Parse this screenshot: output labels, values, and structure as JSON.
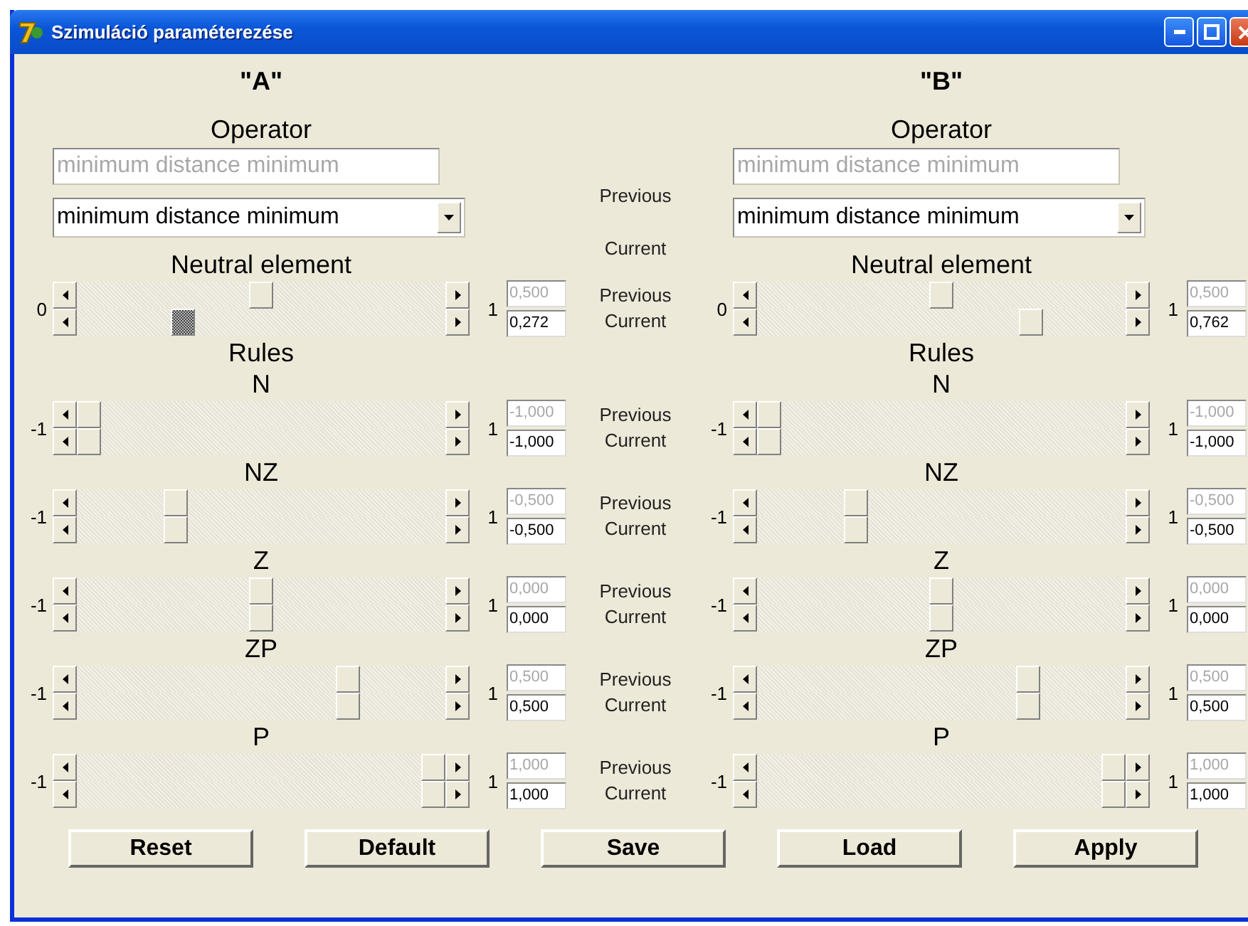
{
  "window": {
    "title": "Szimuláció paraméterezése"
  },
  "headings": [
    "\"A\"",
    "\"B\""
  ],
  "operator": {
    "labels": {
      "previous": "Previous",
      "current": "Current"
    },
    "sides": [
      {
        "title": "Operator",
        "previous_value": "minimum distance minimum",
        "current_value": "minimum distance minimum"
      },
      {
        "title": "Operator",
        "previous_value": "minimum distance minimum",
        "current_value": "minimum distance minimum"
      }
    ]
  },
  "neutral": {
    "labels": {
      "previous": "Previous",
      "current": "Current"
    },
    "sides": [
      {
        "title": "Neutral element",
        "min": "0",
        "max": "1",
        "previous": {
          "level": 0.5,
          "value": "0,500"
        },
        "current": {
          "level": 0.272,
          "value": "0,272",
          "focused": true
        }
      },
      {
        "title": "Neutral element",
        "min": "0",
        "max": "1",
        "previous": {
          "level": 0.5,
          "value": "0,500"
        },
        "current": {
          "level": 0.762,
          "value": "0,762",
          "focused": false
        }
      }
    ]
  },
  "rules_headings": [
    "Rules",
    "Rules"
  ],
  "rules": [
    {
      "labels": {
        "previous": "Previous",
        "current": "Current"
      },
      "sides": [
        {
          "title": "N",
          "min": "-1",
          "max": "1",
          "previous": {
            "level": 0,
            "value": "-1,000"
          },
          "current": {
            "level": 0,
            "value": "-1,000",
            "focused": false
          }
        },
        {
          "title": "N",
          "min": "-1",
          "max": "1",
          "previous": {
            "level": 0,
            "value": "-1,000"
          },
          "current": {
            "level": 0,
            "value": "-1,000",
            "focused": false
          }
        }
      ]
    },
    {
      "labels": {
        "previous": "Previous",
        "current": "Current"
      },
      "sides": [
        {
          "title": "NZ",
          "min": "-1",
          "max": "1",
          "previous": {
            "level": 0.25,
            "value": "-0,500"
          },
          "current": {
            "level": 0.25,
            "value": "-0,500",
            "focused": false
          }
        },
        {
          "title": "NZ",
          "min": "-1",
          "max": "1",
          "previous": {
            "level": 0.25,
            "value": "-0,500"
          },
          "current": {
            "level": 0.25,
            "value": "-0,500",
            "focused": false
          }
        }
      ]
    },
    {
      "labels": {
        "previous": "Previous",
        "current": "Current"
      },
      "sides": [
        {
          "title": "Z",
          "min": "-1",
          "max": "1",
          "previous": {
            "level": 0.5,
            "value": "0,000"
          },
          "current": {
            "level": 0.5,
            "value": "0,000",
            "focused": false
          }
        },
        {
          "title": "Z",
          "min": "-1",
          "max": "1",
          "previous": {
            "level": 0.5,
            "value": "0,000"
          },
          "current": {
            "level": 0.5,
            "value": "0,000",
            "focused": false
          }
        }
      ]
    },
    {
      "labels": {
        "previous": "Previous",
        "current": "Current"
      },
      "sides": [
        {
          "title": "ZP",
          "min": "-1",
          "max": "1",
          "previous": {
            "level": 0.75,
            "value": "0,500"
          },
          "current": {
            "level": 0.75,
            "value": "0,500",
            "focused": false
          }
        },
        {
          "title": "ZP",
          "min": "-1",
          "max": "1",
          "previous": {
            "level": 0.75,
            "value": "0,500"
          },
          "current": {
            "level": 0.75,
            "value": "0,500",
            "focused": false
          }
        }
      ]
    },
    {
      "labels": {
        "previous": "Previous",
        "current": "Current"
      },
      "sides": [
        {
          "title": "P",
          "min": "-1",
          "max": "1",
          "previous": {
            "level": 1,
            "value": "1,000"
          },
          "current": {
            "level": 1,
            "value": "1,000",
            "focused": false
          }
        },
        {
          "title": "P",
          "min": "-1",
          "max": "1",
          "previous": {
            "level": 1,
            "value": "1,000"
          },
          "current": {
            "level": 1,
            "value": "1,000",
            "focused": false
          }
        }
      ]
    }
  ],
  "buttons": [
    "Reset",
    "Default",
    "Save",
    "Load",
    "Apply"
  ]
}
